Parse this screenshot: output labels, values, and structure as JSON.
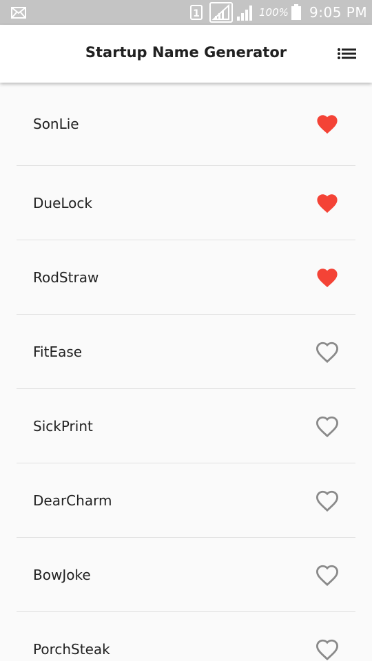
{
  "status_bar": {
    "battery_percent": "100%",
    "time": "9:05 PM",
    "sim_label": "1",
    "icons": [
      "mail-icon",
      "sim-icon",
      "signal-icon",
      "signal-icon",
      "battery-icon"
    ]
  },
  "app_bar": {
    "title": "Startup Name Generator",
    "action_icon": "list-icon"
  },
  "colors": {
    "status_bar_bg": "#c4c4c4",
    "app_bar_bg": "#ffffff",
    "background": "#fafafa",
    "heart_saved": "#f44336",
    "heart_unsaved": "#8a8a8a",
    "divider": "#e0e0e0"
  },
  "list": {
    "items": [
      {
        "name": "SonLie",
        "saved": true
      },
      {
        "name": "DueLock",
        "saved": true
      },
      {
        "name": "RodStraw",
        "saved": true
      },
      {
        "name": "FitEase",
        "saved": false
      },
      {
        "name": "SickPrint",
        "saved": false
      },
      {
        "name": "DearCharm",
        "saved": false
      },
      {
        "name": "BowJoke",
        "saved": false
      },
      {
        "name": "PorchSteak",
        "saved": false
      }
    ]
  }
}
